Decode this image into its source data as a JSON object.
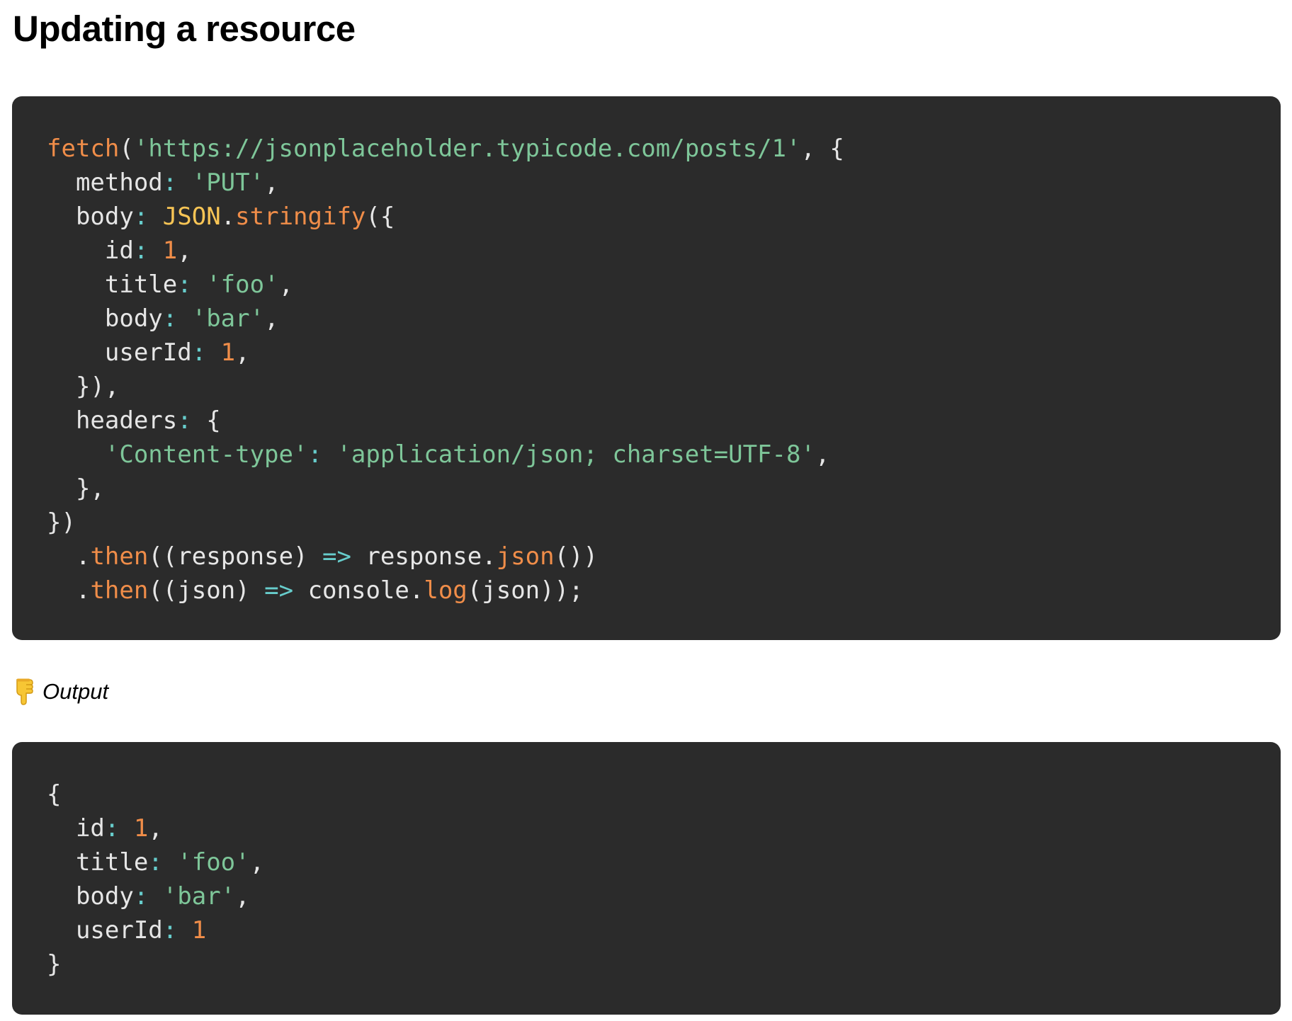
{
  "page": {
    "title": "Updating a resource"
  },
  "request_code": {
    "language": "javascript",
    "lines": [
      [
        [
          "fn",
          "fetch"
        ],
        [
          "punc",
          "("
        ],
        [
          "str",
          "'https://jsonplaceholder.typicode.com/posts/1'"
        ],
        [
          "punc",
          ", {"
        ]
      ],
      [
        [
          "plain",
          "  method"
        ],
        [
          "op",
          ":"
        ],
        [
          "plain",
          " "
        ],
        [
          "str",
          "'PUT'"
        ],
        [
          "punc",
          ","
        ]
      ],
      [
        [
          "plain",
          "  body"
        ],
        [
          "op",
          ":"
        ],
        [
          "plain",
          " "
        ],
        [
          "class",
          "JSON"
        ],
        [
          "punc",
          "."
        ],
        [
          "fn",
          "stringify"
        ],
        [
          "punc",
          "({"
        ]
      ],
      [
        [
          "plain",
          "    id"
        ],
        [
          "op",
          ":"
        ],
        [
          "plain",
          " "
        ],
        [
          "num",
          "1"
        ],
        [
          "punc",
          ","
        ]
      ],
      [
        [
          "plain",
          "    title"
        ],
        [
          "op",
          ":"
        ],
        [
          "plain",
          " "
        ],
        [
          "str",
          "'foo'"
        ],
        [
          "punc",
          ","
        ]
      ],
      [
        [
          "plain",
          "    body"
        ],
        [
          "op",
          ":"
        ],
        [
          "plain",
          " "
        ],
        [
          "str",
          "'bar'"
        ],
        [
          "punc",
          ","
        ]
      ],
      [
        [
          "plain",
          "    userId"
        ],
        [
          "op",
          ":"
        ],
        [
          "plain",
          " "
        ],
        [
          "num",
          "1"
        ],
        [
          "punc",
          ","
        ]
      ],
      [
        [
          "punc",
          "  }),"
        ]
      ],
      [
        [
          "plain",
          "  headers"
        ],
        [
          "op",
          ":"
        ],
        [
          "plain",
          " "
        ],
        [
          "punc",
          "{"
        ]
      ],
      [
        [
          "plain",
          "    "
        ],
        [
          "str",
          "'Content-type'"
        ],
        [
          "op",
          ":"
        ],
        [
          "plain",
          " "
        ],
        [
          "str",
          "'application/json; charset=UTF-8'"
        ],
        [
          "punc",
          ","
        ]
      ],
      [
        [
          "punc",
          "  },"
        ]
      ],
      [
        [
          "punc",
          "})"
        ]
      ],
      [
        [
          "plain",
          "  "
        ],
        [
          "punc",
          "."
        ],
        [
          "fn",
          "then"
        ],
        [
          "punc",
          "(("
        ],
        [
          "plain",
          "response"
        ],
        [
          "punc",
          ")"
        ],
        [
          "plain",
          " "
        ],
        [
          "op",
          "=>"
        ],
        [
          "plain",
          " response"
        ],
        [
          "punc",
          "."
        ],
        [
          "fn",
          "json"
        ],
        [
          "punc",
          "())"
        ]
      ],
      [
        [
          "plain",
          "  "
        ],
        [
          "punc",
          "."
        ],
        [
          "fn",
          "then"
        ],
        [
          "punc",
          "(("
        ],
        [
          "plain",
          "json"
        ],
        [
          "punc",
          ")"
        ],
        [
          "plain",
          " "
        ],
        [
          "op",
          "=>"
        ],
        [
          "plain",
          " console"
        ],
        [
          "punc",
          "."
        ],
        [
          "fn",
          "log"
        ],
        [
          "punc",
          "("
        ],
        [
          "plain",
          "json"
        ],
        [
          "punc",
          "));"
        ]
      ]
    ]
  },
  "output_label": {
    "icon": "backhand-index-pointing-down-icon",
    "text": "Output"
  },
  "output_code": {
    "language": "javascript",
    "lines": [
      [
        [
          "punc",
          "{"
        ]
      ],
      [
        [
          "plain",
          "  id"
        ],
        [
          "op",
          ":"
        ],
        [
          "plain",
          " "
        ],
        [
          "num",
          "1"
        ],
        [
          "punc",
          ","
        ]
      ],
      [
        [
          "plain",
          "  title"
        ],
        [
          "op",
          ":"
        ],
        [
          "plain",
          " "
        ],
        [
          "str",
          "'foo'"
        ],
        [
          "punc",
          ","
        ]
      ],
      [
        [
          "plain",
          "  body"
        ],
        [
          "op",
          ":"
        ],
        [
          "plain",
          " "
        ],
        [
          "str",
          "'bar'"
        ],
        [
          "punc",
          ","
        ]
      ],
      [
        [
          "plain",
          "  userId"
        ],
        [
          "op",
          ":"
        ],
        [
          "plain",
          " "
        ],
        [
          "num",
          "1"
        ]
      ],
      [
        [
          "punc",
          "}"
        ]
      ]
    ]
  },
  "colors": {
    "page_background": "#ffffff",
    "code_background": "#2b2b2b",
    "default_text": "#e6e6e6",
    "function": "#f08d49",
    "string": "#7ec699",
    "number": "#f08d49",
    "operator": "#67cdcc",
    "class_name": "#f8c555"
  }
}
